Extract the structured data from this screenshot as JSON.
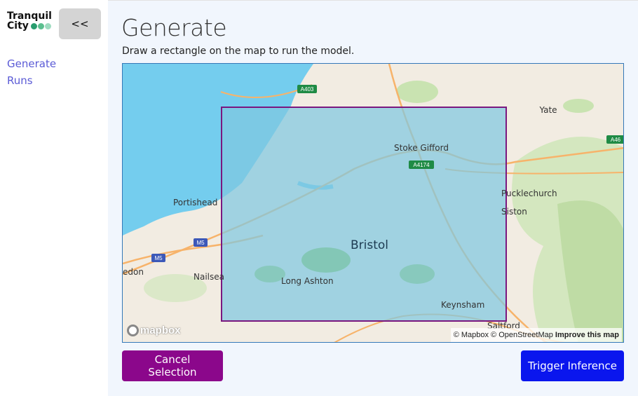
{
  "sidebar": {
    "brand_line1": "Tranquil",
    "brand_line2": "City",
    "collapse_label": "<<",
    "nav": [
      {
        "label": "Generate"
      },
      {
        "label": "Runs"
      }
    ]
  },
  "main": {
    "title": "Generate",
    "subtitle": "Draw a rectangle on the map to run the model."
  },
  "map": {
    "places": [
      {
        "label": "Bristol"
      },
      {
        "label": "Stoke Gifford"
      },
      {
        "label": "Yate"
      },
      {
        "label": "Pucklechurch"
      },
      {
        "label": "Siston"
      },
      {
        "label": "Portishead"
      },
      {
        "label": "Nailsea"
      },
      {
        "label": "Long Ashton"
      },
      {
        "label": "Keynsham"
      },
      {
        "label": "Saltford"
      },
      {
        "label": "edon"
      }
    ],
    "road_shields": [
      {
        "label": "A403"
      },
      {
        "label": "A4174"
      },
      {
        "label": "A46"
      },
      {
        "label": "M5"
      },
      {
        "label": "M5"
      }
    ],
    "logo_text": "mapbox",
    "attribution_text": "© Mapbox © OpenStreetMap",
    "improve_link": "Improve this map",
    "colors": {
      "water": "#74cdee",
      "land": "#f2ece2",
      "park": "#b9dca0",
      "selection_fill": "#7fc7e0",
      "selection_border": "#7a177f"
    }
  },
  "actions": {
    "cancel_label": "Cancel Selection",
    "trigger_label": "Trigger Inference"
  }
}
